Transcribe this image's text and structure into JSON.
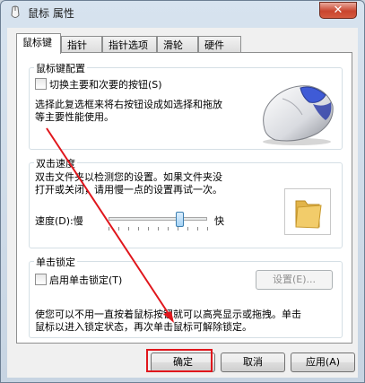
{
  "window": {
    "title": "鼠标 属性",
    "close_glyph": "✕"
  },
  "tabs": [
    {
      "label": "鼠标键",
      "active": true
    },
    {
      "label": "指针",
      "active": false
    },
    {
      "label": "指针选项",
      "active": false
    },
    {
      "label": "滑轮",
      "active": false
    },
    {
      "label": "硬件",
      "active": false
    }
  ],
  "button_config": {
    "title": "鼠标键配置",
    "checkbox_label": "切换主要和次要的按钮(S)",
    "checked": false,
    "desc_line1": "选择此复选框来将右按钮设成如选择和拖放",
    "desc_line2": "等主要性能使用。"
  },
  "double_click": {
    "title": "双击速度",
    "desc_line1": "双击文件夹以检测您的设置。如果文件夹没",
    "desc_line2": "打开或关闭，请用慢一点的设置再试一次。",
    "speed_label": "速度(D):",
    "slow_label": "慢",
    "fast_label": "快",
    "speed_level": 0.72
  },
  "click_lock": {
    "title": "单击锁定",
    "checkbox_label": "启用单击锁定(T)",
    "checked": false,
    "settings_button": "设置(E)...",
    "desc_line1": "使您可以不用一直按着鼠标按钮就可以高亮显示或拖拽。单击",
    "desc_line2": "鼠标以进入锁定状态，再次单击鼠标可解除锁定。"
  },
  "footer": {
    "ok": "确定",
    "cancel": "取消",
    "apply": "应用(A)"
  },
  "colors": {
    "highlight": "#e0161c",
    "arrow": "#e0161c"
  }
}
